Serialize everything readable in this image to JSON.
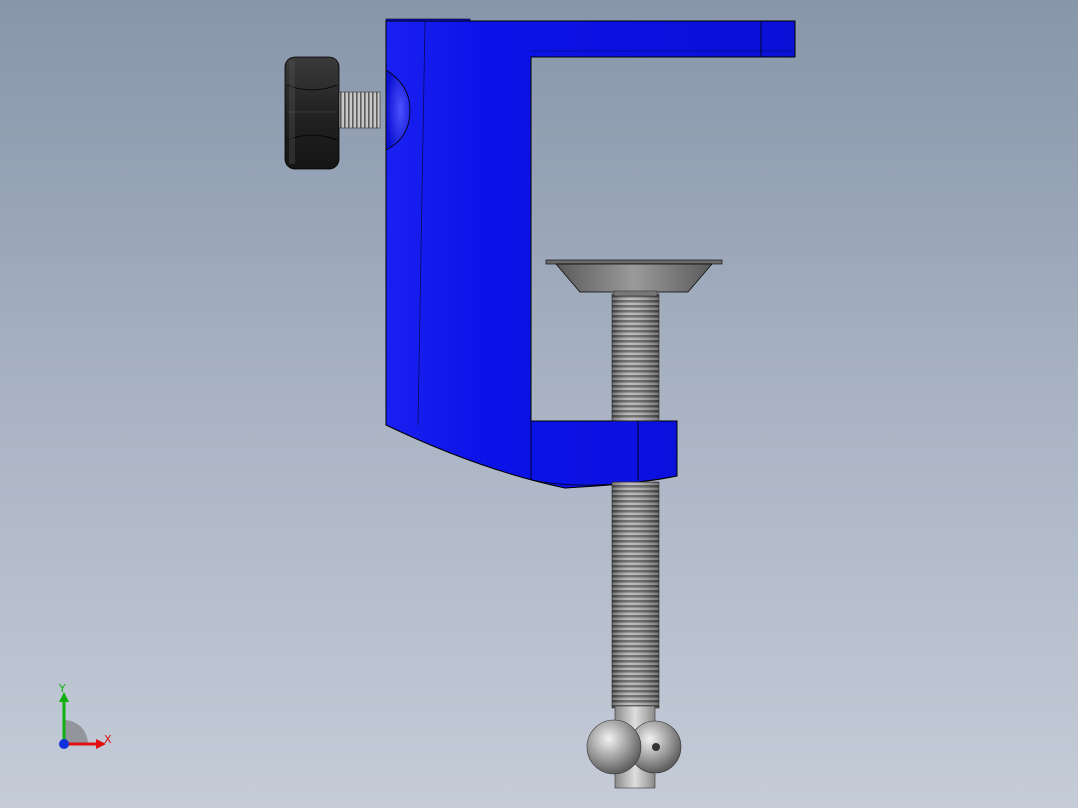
{
  "viewport": {
    "background_top": "#8796aa",
    "background_bottom": "#c5ccd8"
  },
  "model": {
    "body_color": "#0a14e6",
    "knob_color": "#2a2a2a",
    "thread_color": "#9a9a9a",
    "pad_color": "#7d7d7d",
    "ball_color": "#a8a8a8"
  },
  "triad": {
    "x_label": "X",
    "y_label": "Y",
    "x_color": "#e01010",
    "y_color": "#10b010",
    "z_color": "#1030e0"
  }
}
